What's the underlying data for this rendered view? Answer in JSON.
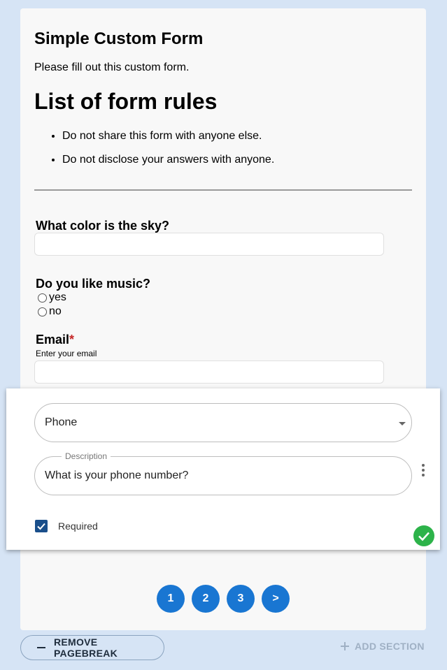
{
  "form": {
    "title": "Simple Custom Form",
    "description": "Please fill out this custom form.",
    "rules_heading": "List of form rules",
    "rules": [
      "Do not share this form with anyone else.",
      "Do not disclose your answers with anyone."
    ]
  },
  "questions": {
    "sky": {
      "label": "What color is the sky?",
      "value": ""
    },
    "music": {
      "label": "Do you like music?",
      "options": [
        "yes",
        "no"
      ]
    },
    "email": {
      "label": "Email",
      "required_mark": "*",
      "help": "Enter your email",
      "value": ""
    }
  },
  "editor": {
    "type_value": "Phone",
    "description_legend": "Description",
    "description_value": "What is your phone number?",
    "required_label": "Required",
    "required_checked": true
  },
  "pagination": {
    "pages": [
      "1",
      "2",
      "3"
    ],
    "next": ">"
  },
  "footer": {
    "remove_pagebreak": "REMOVE PAGEBREAK",
    "add_section": "ADD SECTION"
  },
  "colors": {
    "primary": "#1976d2",
    "checkbox": "#1a4f8b",
    "success": "#2db34a",
    "required": "#c62828"
  }
}
